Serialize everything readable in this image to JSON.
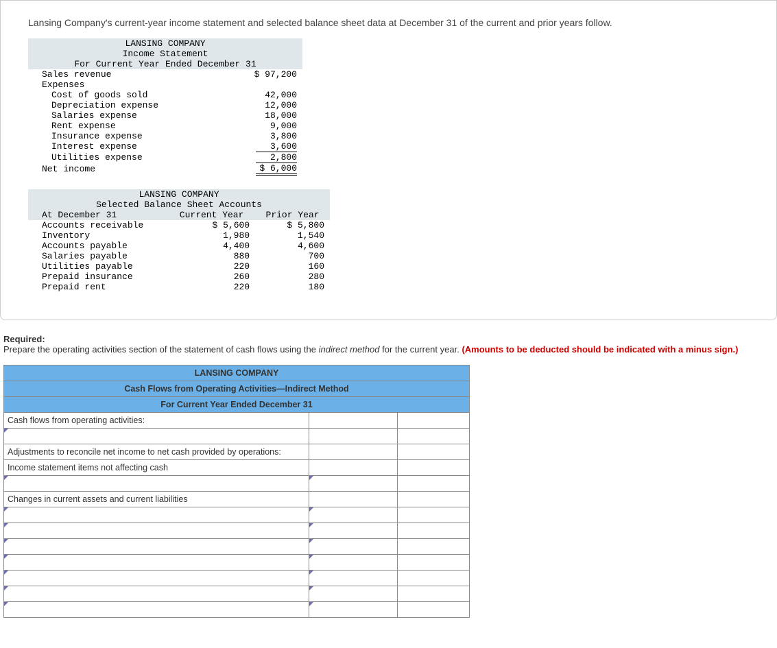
{
  "intro": "Lansing Company's current-year income statement and selected balance sheet data at December 31 of the current and prior years follow.",
  "income": {
    "company": "LANSING COMPANY",
    "title": "Income Statement",
    "period": "For Current Year Ended December 31",
    "rows": {
      "sales_revenue_label": "Sales revenue",
      "sales_revenue": "$ 97,200",
      "expenses_label": "Expenses",
      "cogs_label": "Cost of goods sold",
      "cogs": "42,000",
      "dep_label": "Depreciation expense",
      "dep": "12,000",
      "sal_label": "Salaries expense",
      "sal": "18,000",
      "rent_label": "Rent expense",
      "rent": "9,000",
      "ins_label": "Insurance expense",
      "ins": "3,800",
      "int_label": "Interest expense",
      "int": "3,600",
      "util_label": "Utilities expense",
      "util": "2,800",
      "net_label": "Net income",
      "net": "$ 6,000"
    }
  },
  "balance": {
    "company": "LANSING COMPANY",
    "title": "Selected Balance Sheet Accounts",
    "col0": "At December 31",
    "col1": "Current Year",
    "col2": "Prior Year",
    "rows": [
      {
        "label": "Accounts receivable",
        "cy": "$ 5,600",
        "py": "$ 5,800"
      },
      {
        "label": "Inventory",
        "cy": "1,980",
        "py": "1,540"
      },
      {
        "label": "Accounts payable",
        "cy": "4,400",
        "py": "4,600"
      },
      {
        "label": "Salaries payable",
        "cy": "880",
        "py": "700"
      },
      {
        "label": "Utilities payable",
        "cy": "220",
        "py": "160"
      },
      {
        "label": "Prepaid insurance",
        "cy": "260",
        "py": "280"
      },
      {
        "label": "Prepaid rent",
        "cy": "220",
        "py": "180"
      }
    ]
  },
  "required": {
    "title": "Required:",
    "body_pre": "Prepare the operating activities section of the statement of cash flows using the ",
    "body_em": "indirect method",
    "body_post": " for the current year. ",
    "red": "(Amounts to be deducted should be indicated with a minus sign.)"
  },
  "worksheet": {
    "h1": "LANSING COMPANY",
    "h2": "Cash Flows from Operating Activities—Indirect Method",
    "h3": "For Current Year Ended December 31",
    "labels": {
      "cfo": "Cash flows from operating activities:",
      "adj": "Adjustments to reconcile net income to net cash provided by operations:",
      "items": "Income statement items not affecting cash",
      "changes": "Changes in current assets and current liabilities"
    }
  }
}
